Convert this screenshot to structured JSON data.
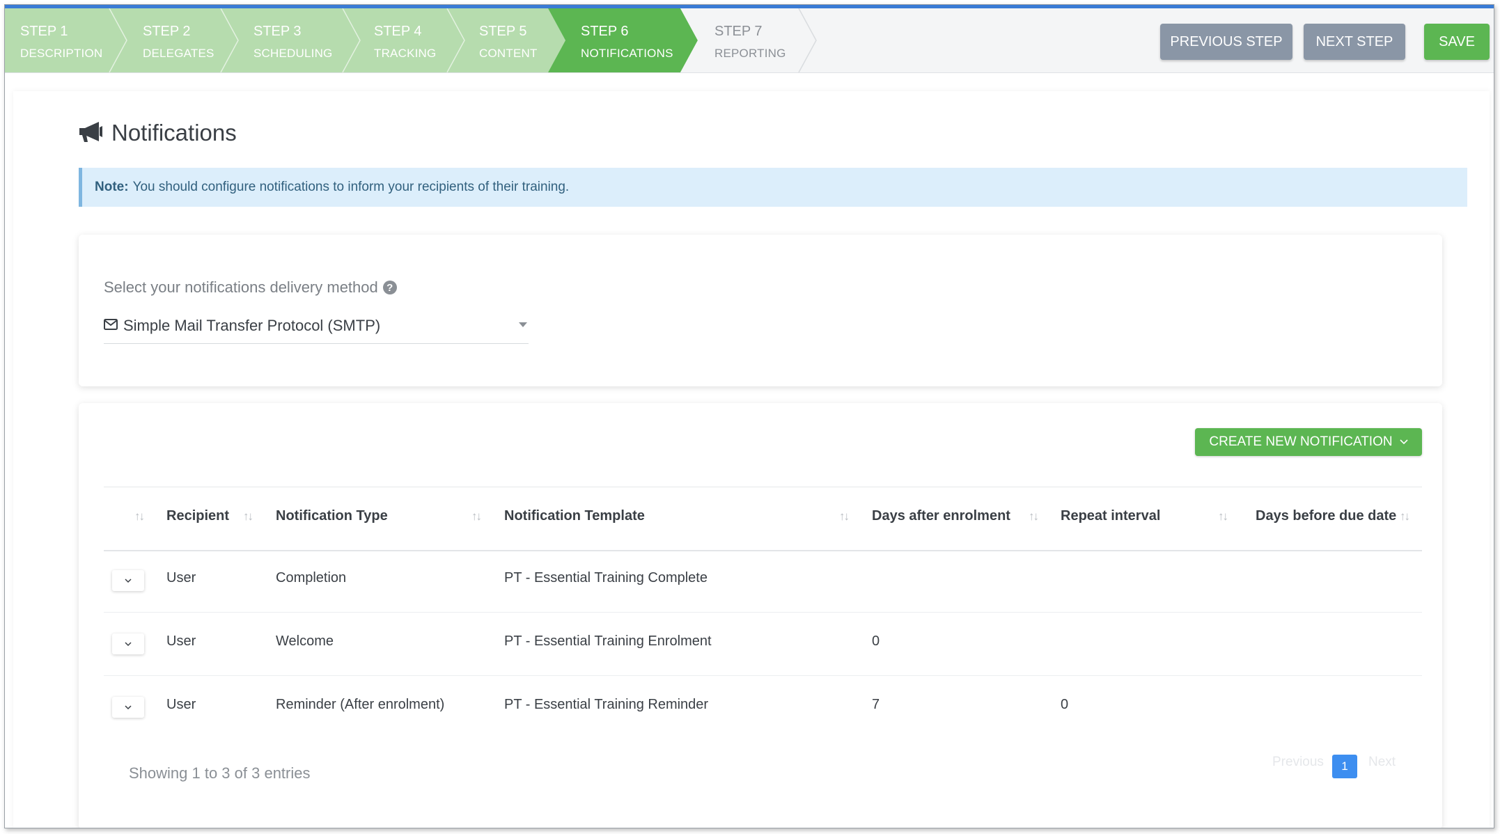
{
  "wizard": {
    "steps": [
      {
        "num": "STEP 1",
        "name": "DESCRIPTION"
      },
      {
        "num": "STEP 2",
        "name": "DELEGATES"
      },
      {
        "num": "STEP 3",
        "name": "SCHEDULING"
      },
      {
        "num": "STEP 4",
        "name": "TRACKING"
      },
      {
        "num": "STEP 5",
        "name": "CONTENT"
      },
      {
        "num": "STEP 6",
        "name": "NOTIFICATIONS"
      },
      {
        "num": "STEP 7",
        "name": "REPORTING"
      }
    ],
    "active_step": 6
  },
  "toolbar": {
    "previous_label": "PREVIOUS STEP",
    "next_label": "NEXT STEP",
    "save_label": "SAVE"
  },
  "page": {
    "title": "Notifications",
    "title_icon": "bullhorn-icon"
  },
  "note": {
    "label": "Note:",
    "text": "You should configure notifications to inform your recipients of their training."
  },
  "delivery": {
    "label": "Select your notifications delivery method",
    "help_icon": "question-circle-icon",
    "value_icon": "envelope-icon",
    "value": "Simple Mail Transfer Protocol (SMTP)"
  },
  "notifications": {
    "create_label": "CREATE NEW NOTIFICATION",
    "columns": [
      "Recipient",
      "Notification Type",
      "Notification Template",
      "Days after enrolment",
      "Repeat interval",
      "Days before due date"
    ],
    "rows": [
      {
        "recipient": "User",
        "type": "Completion",
        "template": "PT - Essential Training Complete",
        "days_after": "",
        "repeat": "",
        "days_before": ""
      },
      {
        "recipient": "User",
        "type": "Welcome",
        "template": "PT - Essential Training Enrolment",
        "days_after": "0",
        "repeat": "",
        "days_before": ""
      },
      {
        "recipient": "User",
        "type": "Reminder (After enrolment)",
        "template": "PT - Essential Training Reminder",
        "days_after": "7",
        "repeat": "0",
        "days_before": ""
      }
    ],
    "info": "Showing 1 to 3 of 3 entries",
    "pagination": {
      "previous": "Previous",
      "current": "1",
      "next": "Next"
    }
  },
  "colors": {
    "completed_step": "#b6dcae",
    "active_step": "#5cb652",
    "upcoming_step": "#ffffff",
    "accent_blue": "#3a7bd5",
    "note_bg": "#dceefb"
  }
}
